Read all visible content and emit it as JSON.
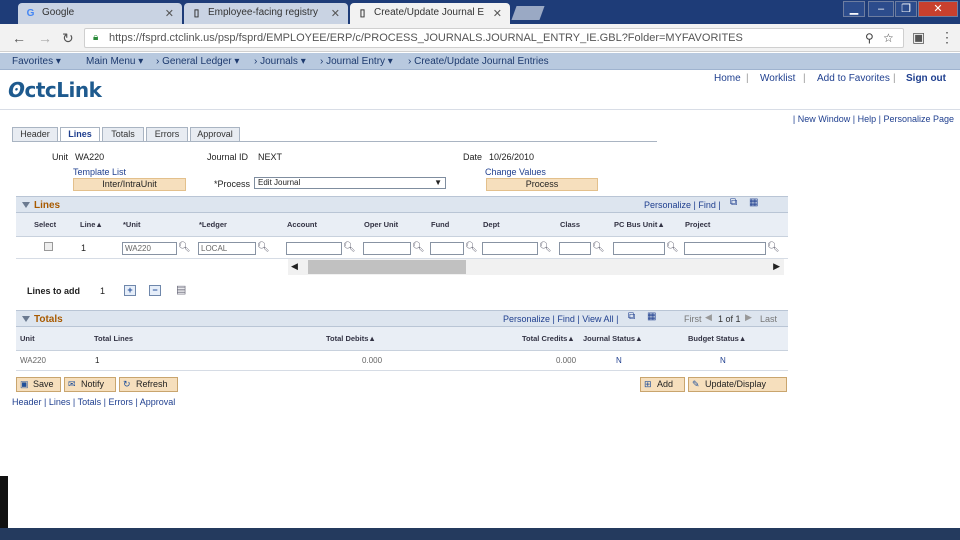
{
  "browser": {
    "tabs": [
      {
        "title": "Google",
        "favicon": "google-icon"
      },
      {
        "title": "Employee-facing registry",
        "favicon": "page-icon"
      },
      {
        "title": "Create/Update Journal E",
        "favicon": "page-icon"
      }
    ],
    "url": "https://fsprd.ctclink.us/psp/fsprd/EMPLOYEE/ERP/c/PROCESS_JOURNALS.JOURNAL_ENTRY_IE.GBL?Folder=MYFAVORITES"
  },
  "menubar": {
    "favorites": "Favorites",
    "main_menu": "Main Menu",
    "crumbs": [
      "General Ledger",
      "Journals",
      "Journal Entry",
      "Create/Update Journal Entries"
    ]
  },
  "brand": {
    "logo": "ctcLink",
    "links": [
      "Home",
      "Worklist",
      "Add to Favorites",
      "Sign out"
    ]
  },
  "util_links": [
    "New Window",
    "Help",
    "Personalize Page"
  ],
  "page_tabs": [
    "Header",
    "Lines",
    "Totals",
    "Errors",
    "Approval"
  ],
  "header": {
    "unit_label": "Unit",
    "unit_value": "WA220",
    "journal_label": "Journal ID",
    "journal_value": "NEXT",
    "date_label": "Date",
    "date_value": "10/26/2010",
    "template_list": "Template List",
    "inter_btn": "Inter/IntraUnit",
    "process_label": "*Process",
    "process_value": "Edit Journal",
    "change_values": "Change Values",
    "process_btn": "Process"
  },
  "lines": {
    "title": "Lines",
    "tools": "Personalize | Find |",
    "columns": [
      "Select",
      "Line",
      "*Unit",
      "*Ledger",
      "Account",
      "Oper Unit",
      "Fund",
      "Dept",
      "Class",
      "PC Bus Unit",
      "Project"
    ],
    "row": {
      "line": "1",
      "unit": "WA220",
      "ledger": "LOCAL"
    },
    "lines_to_add_label": "Lines to add",
    "lines_to_add_value": "1"
  },
  "totals": {
    "title": "Totals",
    "tools": "Personalize | Find | View All |",
    "nav_first": "First",
    "nav_range": "1 of 1",
    "nav_last": "Last",
    "columns": [
      "Unit",
      "Total Lines",
      "Total Debits",
      "Total Credits",
      "Journal Status",
      "Budget Status"
    ],
    "row": {
      "unit": "WA220",
      "total_lines": "1",
      "total_debits": "0.000",
      "total_credits": "0.000",
      "journal_status": "N",
      "budget_status": "N"
    }
  },
  "actions": {
    "save": "Save",
    "notify": "Notify",
    "refresh": "Refresh",
    "add": "Add",
    "update": "Update/Display"
  },
  "bottom_links": [
    "Header",
    "Lines",
    "Totals",
    "Errors",
    "Approval"
  ]
}
